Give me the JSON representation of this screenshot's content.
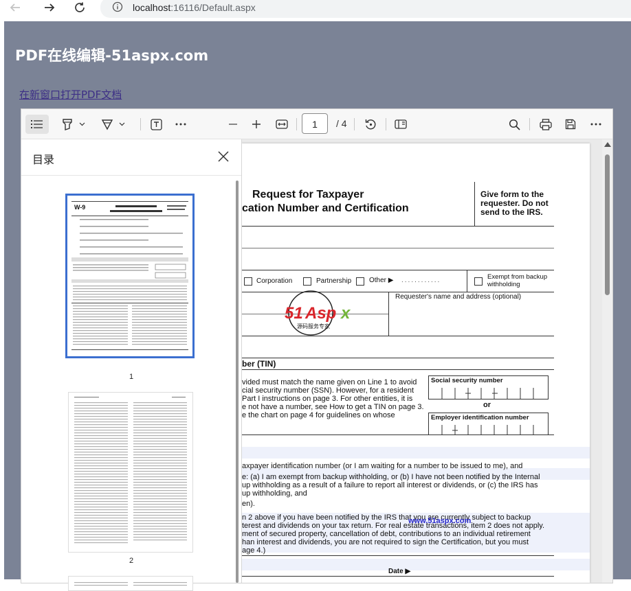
{
  "browser": {
    "url_host": "localhost",
    "url_rest": ":16116/Default.aspx",
    "back_icon": "arrow-left-icon",
    "forward_icon": "arrow-right-icon",
    "reload_icon": "reload-icon",
    "info_icon": "info-icon"
  },
  "page": {
    "title": "PDF在线编辑-51aspx.com",
    "open_link": "在新窗口打开PDF文档"
  },
  "viewer": {
    "page_number": "1",
    "page_total": "/ 4",
    "sidebar": {
      "title": "目录",
      "thumbnails": [
        {
          "label": "1"
        },
        {
          "label": "2"
        }
      ]
    }
  },
  "document": {
    "title_line1": "Request for Taxpayer",
    "title_line2": "cation Number and Certification",
    "give_form": [
      "Give form to the",
      "requester. Do not",
      "send to the IRS."
    ],
    "corporation": "Corporation",
    "partnership": "Partnership",
    "other": "Other ▶",
    "exempt": [
      "Exempt from backup",
      "withholding"
    ],
    "requester": "Requester's name and address (optional)",
    "watermark_logo": "51Aspx",
    "watermark_sub": "源码服务专家",
    "part1_heading": "ber (TIN)",
    "tin_text": [
      "vided must match the name given on Line 1 to avoid",
      "cial security number (SSN). However, for a resident",
      " Part I instructions on page 3. For other entities, it is",
      "e not have a number, see How to get a TIN on page 3.",
      "e the chart on page 4 for guidelines on whose"
    ],
    "ssn_label": "Social security number",
    "or_label": "or",
    "ein_label": "Employer identification number",
    "cert_text": [
      "axpayer identification number (or I am waiting for a number to be issued to me), and",
      "e: (a) I am exempt from backup withholding, or (b) I have not been notified by the Internal",
      "up withholding as a result of a failure to report all interest or dividends, or (c) the IRS has",
      "up withholding, and",
      "en).",
      "n 2 above if you have been notified by the IRS that you are currently subject to backup",
      "terest and dividends on your tax return. For real estate transactions, item 2 does not apply.",
      "ment of secured property, cancellation of debt, contributions to an individual retirement",
      "han interest and dividends, you are not required to sign the Certification, but you must",
      "age 4.)"
    ],
    "site_watermark": "www.51aspx.com",
    "date_label": "Date ▶"
  },
  "colors": {
    "page_bg": "#7b8396",
    "link": "#3d2f86",
    "thumb_selected": "#3b6fd0",
    "watermark_red": "#d9262c",
    "watermark_green": "#74b53a"
  }
}
